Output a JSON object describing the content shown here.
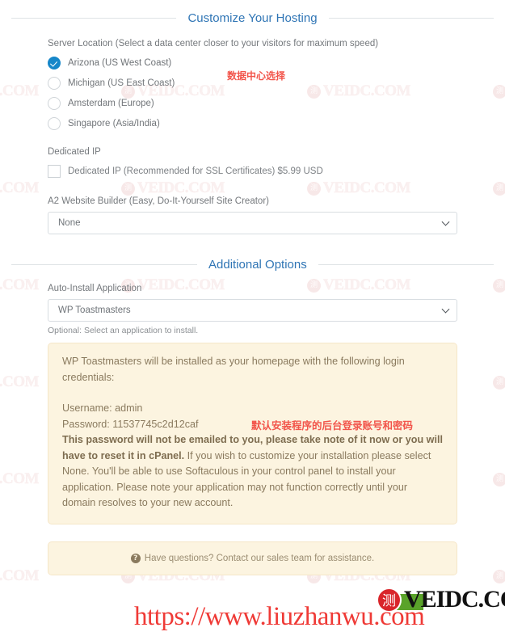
{
  "sections": {
    "customize": {
      "title": "Customize Your Hosting"
    },
    "additional": {
      "title": "Additional Options"
    }
  },
  "server_location": {
    "label": "Server Location (Select a data center closer to your visitors for maximum speed)",
    "options": [
      {
        "label": "Arizona (US West Coast)",
        "selected": true
      },
      {
        "label": "Michigan (US East Coast)",
        "selected": false
      },
      {
        "label": "Amsterdam (Europe)",
        "selected": false
      },
      {
        "label": "Singapore (Asia/India)",
        "selected": false
      }
    ]
  },
  "dedicated_ip": {
    "label": "Dedicated IP",
    "checkbox_label": "Dedicated IP (Recommended for SSL Certificates) $5.99 USD",
    "checked": false
  },
  "website_builder": {
    "label": "A2 Website Builder (Easy, Do-It-Yourself Site Creator)",
    "value": "None"
  },
  "auto_install": {
    "label": "Auto-Install Application",
    "value": "WP Toastmasters",
    "hint": "Optional: Select an application to install."
  },
  "install_alert": {
    "intro": "WP Toastmasters will be installed as your homepage with the following login credentials:",
    "username_line": "Username: admin",
    "password_line": "Password: 11537745c2d12caf",
    "warning_bold": "This password will not be emailed to you, please take note of it now or you will have to reset it in cPanel.",
    "warning_rest": " If you wish to customize your installation please select None. You'll be able to use Softaculous in your control panel to install your application. Please note your application may not function correctly until your domain resolves to your new account."
  },
  "help_alert": {
    "text": "Have questions? Contact our sales team for assistance."
  },
  "annotations": [
    {
      "id": "anno-dc",
      "text": "数据中心选择"
    },
    {
      "id": "anno-cred",
      "text": "默认安装程序的后台登录账号和密码"
    }
  ],
  "branding": {
    "logo_badge": "测",
    "logo_text": "VEIDC.COM",
    "site_url": "https://www.liuzhanwu.com",
    "watermark_badge": "测",
    "watermark_text": "VEIDC.COM"
  },
  "colors": {
    "accent_blue": "#2f75b5",
    "radio_selected": "#1787c9",
    "alert_bg": "#fcf4e0",
    "alert_border": "#f5e6c8",
    "annotation_red": "#f2554b",
    "brand_red": "#d9252a"
  }
}
